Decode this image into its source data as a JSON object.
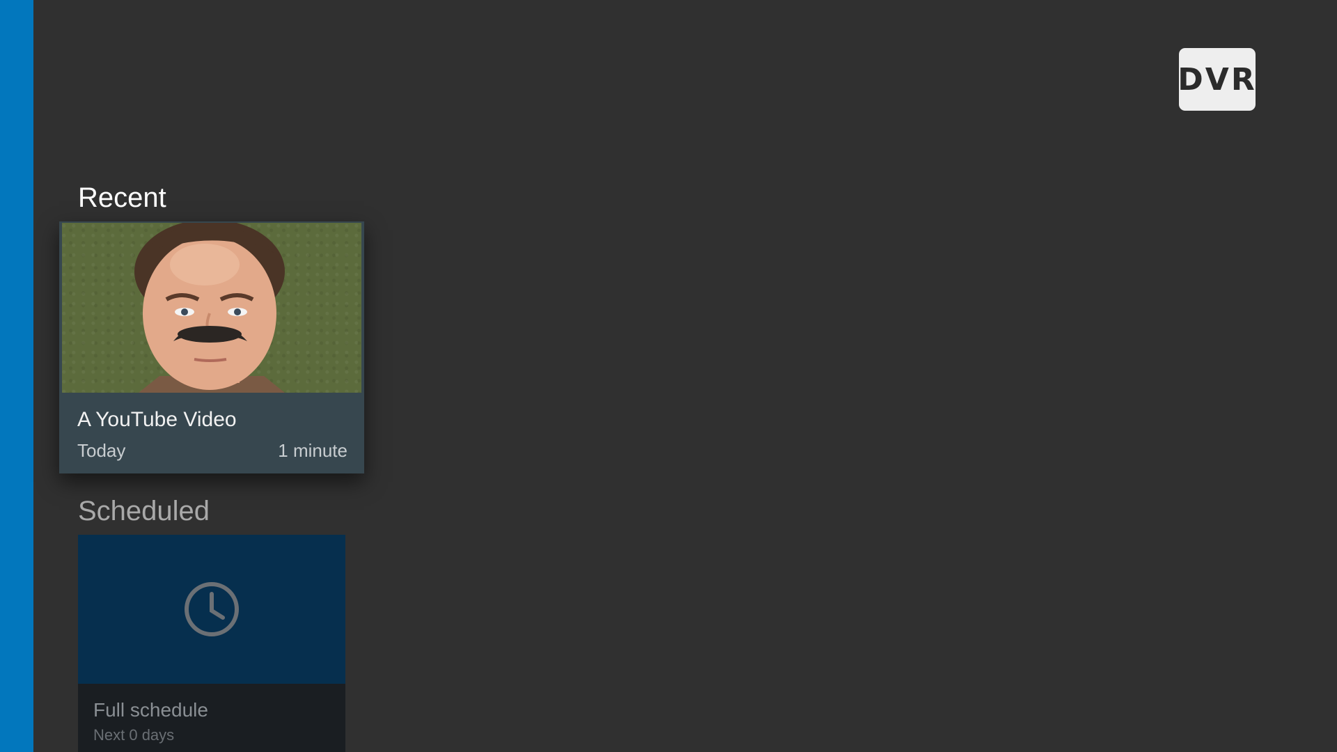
{
  "brand": {
    "badge_text": "DVR",
    "rail_color": "#0277bd"
  },
  "sections": {
    "recent_title": "Recent",
    "scheduled_title": "Scheduled"
  },
  "recent_items": [
    {
      "title": "A YouTube Video",
      "date": "Today",
      "duration": "1 minute",
      "thumbnail_icon": "video-thumbnail"
    }
  ],
  "scheduled_items": [
    {
      "title": "Full schedule",
      "subtitle": "Next 0 days",
      "icon": "clock-icon"
    }
  ]
}
